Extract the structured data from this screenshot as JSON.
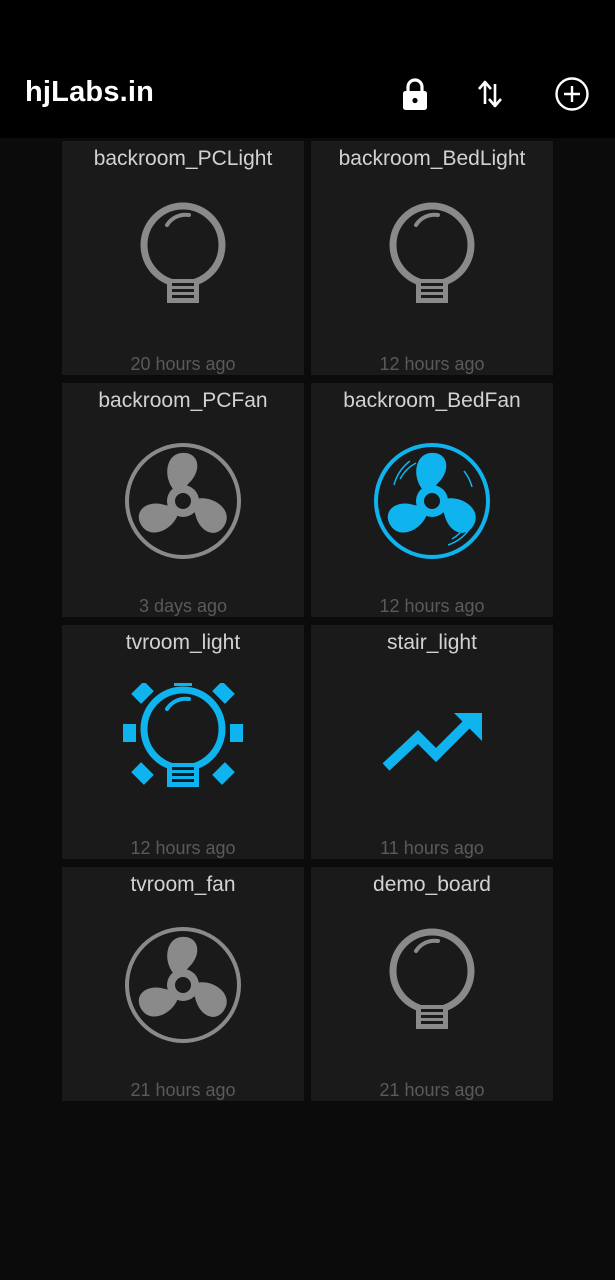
{
  "app": {
    "title": "hjLabs.in"
  },
  "toolbar": {
    "actions": [
      {
        "name": "lock-icon"
      },
      {
        "name": "sort-arrows-icon"
      },
      {
        "name": "add-circle-icon"
      }
    ]
  },
  "colors": {
    "active": "#0fb4ef",
    "inactive": "#8a8a8a",
    "tile": "#1a1a1a"
  },
  "devices": [
    {
      "name": "backroom_PCLight",
      "time": "20 hours ago",
      "icon": "bulb-icon",
      "active": false
    },
    {
      "name": "backroom_BedLight",
      "time": "12 hours ago",
      "icon": "bulb-icon",
      "active": false
    },
    {
      "name": "backroom_PCFan",
      "time": "3 days ago",
      "icon": "fan-icon",
      "active": false
    },
    {
      "name": "backroom_BedFan",
      "time": "12 hours ago",
      "icon": "fan-icon",
      "active": true
    },
    {
      "name": "tvroom_light",
      "time": "12 hours ago",
      "icon": "bulb-icon",
      "active": true
    },
    {
      "name": "stair_light",
      "time": "11 hours ago",
      "icon": "trend-arrow-icon",
      "active": true
    },
    {
      "name": "tvroom_fan",
      "time": "21 hours ago",
      "icon": "fan-icon",
      "active": false
    },
    {
      "name": "demo_board",
      "time": "21 hours ago",
      "icon": "bulb-icon",
      "active": false
    }
  ]
}
